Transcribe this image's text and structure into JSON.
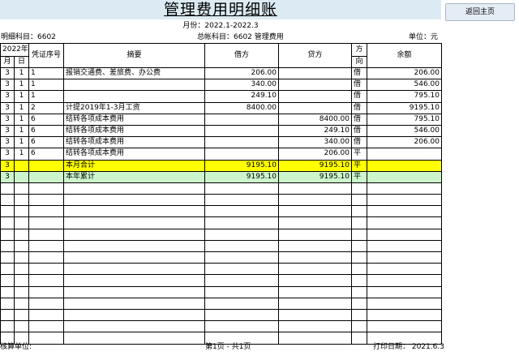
{
  "title": "管理费用明细账",
  "period_label": "月份：2022.1-2022.3",
  "detail_account_label": "明细科目：6602",
  "general_account_label": "总帐科目：6602  管理费用",
  "unit_label": "单位：元",
  "home_button": "返回主页",
  "headers": {
    "year": "2022年",
    "month": "月",
    "day": "日",
    "voucher": "凭证序号",
    "summary": "摘要",
    "debit": "借方",
    "credit": "贷方",
    "direction_1": "方",
    "direction_2": "向",
    "balance": "余额"
  },
  "rows": [
    {
      "month": "3",
      "day": "1",
      "voucher": "1",
      "summary": "报销交通费、差旅费、办公费",
      "debit": "206.00",
      "credit": "",
      "dir": "借",
      "balance": "206.00",
      "style": ""
    },
    {
      "month": "3",
      "day": "1",
      "voucher": "1",
      "summary": "",
      "debit": "340.00",
      "credit": "",
      "dir": "借",
      "balance": "546.00",
      "style": ""
    },
    {
      "month": "3",
      "day": "1",
      "voucher": "1",
      "summary": "",
      "debit": "249.10",
      "credit": "",
      "dir": "借",
      "balance": "795.10",
      "style": ""
    },
    {
      "month": "3",
      "day": "1",
      "voucher": "2",
      "summary": "计提2019年1-3月工资",
      "debit": "8400.00",
      "credit": "",
      "dir": "借",
      "balance": "9195.10",
      "style": ""
    },
    {
      "month": "3",
      "day": "1",
      "voucher": "6",
      "summary": "结转各项成本费用",
      "debit": "",
      "credit": "8400.00",
      "dir": "借",
      "balance": "795.10",
      "style": ""
    },
    {
      "month": "3",
      "day": "1",
      "voucher": "6",
      "summary": "结转各项成本费用",
      "debit": "",
      "credit": "249.10",
      "dir": "借",
      "balance": "546.00",
      "style": ""
    },
    {
      "month": "3",
      "day": "1",
      "voucher": "6",
      "summary": "结转各项成本费用",
      "debit": "",
      "credit": "340.00",
      "dir": "借",
      "balance": "206.00",
      "style": ""
    },
    {
      "month": "3",
      "day": "1",
      "voucher": "6",
      "summary": "结转各项成本费用",
      "debit": "",
      "credit": "206.00",
      "dir": "平",
      "balance": "",
      "style": ""
    },
    {
      "month": "3",
      "day": "",
      "voucher": "",
      "summary": "本月合计",
      "debit": "9195.10",
      "credit": "9195.10",
      "dir": "平",
      "balance": "",
      "style": "month"
    },
    {
      "month": "3",
      "day": "",
      "voucher": "",
      "summary": "本年累计",
      "debit": "9195.10",
      "credit": "9195.10",
      "dir": "平",
      "balance": "",
      "style": "year"
    }
  ],
  "footer": {
    "accountant": "核算单位:",
    "pages": "第1页 - 共1页",
    "print_date": "打印日期：  2021.6.3"
  },
  "colors": {
    "title_band": "#dcebf3",
    "month_total_row": "#ffff00",
    "year_total_row": "#ccf5cc"
  }
}
